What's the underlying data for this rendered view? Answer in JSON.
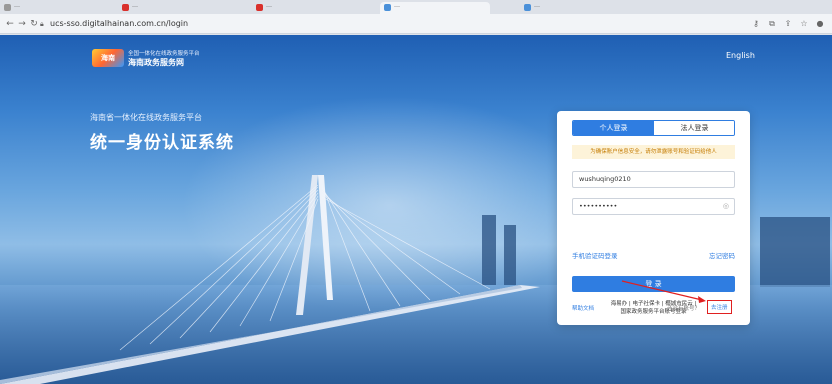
{
  "browser": {
    "tabs": [
      {
        "label": "…",
        "color": "#999999",
        "active": false
      },
      {
        "label": "…",
        "color": "#d9302c",
        "active": false
      },
      {
        "label": "…",
        "color": "#d9302c",
        "active": false
      },
      {
        "label": "…",
        "color": "#4a90d9",
        "active": true
      },
      {
        "label": "…",
        "color": "#4a90d9",
        "active": false
      }
    ],
    "back_icon": "arrow-left-icon",
    "forward_icon": "arrow-right-icon",
    "reload_icon": "reload-icon",
    "url": "ucs-sso.digitalhainan.com.cn/login"
  },
  "header": {
    "logo_text": "海南",
    "brand_line1": "全国一体化在线政务服务平台",
    "brand_line2": "海南政务服务网",
    "language_link": "English"
  },
  "hero": {
    "subtitle": "海南省一体化在线政务服务平台",
    "title": "统一身份认证系统"
  },
  "login": {
    "tab_personal": "个人登录",
    "tab_corporate": "法人登录",
    "notice": "为确保账户信息安全，请勿泄露账号和验证码给他人",
    "username_value": "wushuqing0210",
    "password_value": "••••••••••",
    "sms_login_link": "手机验证码登录",
    "forgot_password_link": "忘记密码",
    "login_button": "登 录",
    "alt_login_line1": "海易办 | 电子社保卡 | 椰城市民云 |",
    "alt_login_line2": "国家政务服务平台账号登录",
    "help_link": "帮助文档",
    "no_account_text": "还没有账号？",
    "register_link": "去注册"
  },
  "colors": {
    "primary": "#2f7de1",
    "highlight": "#e02020"
  }
}
